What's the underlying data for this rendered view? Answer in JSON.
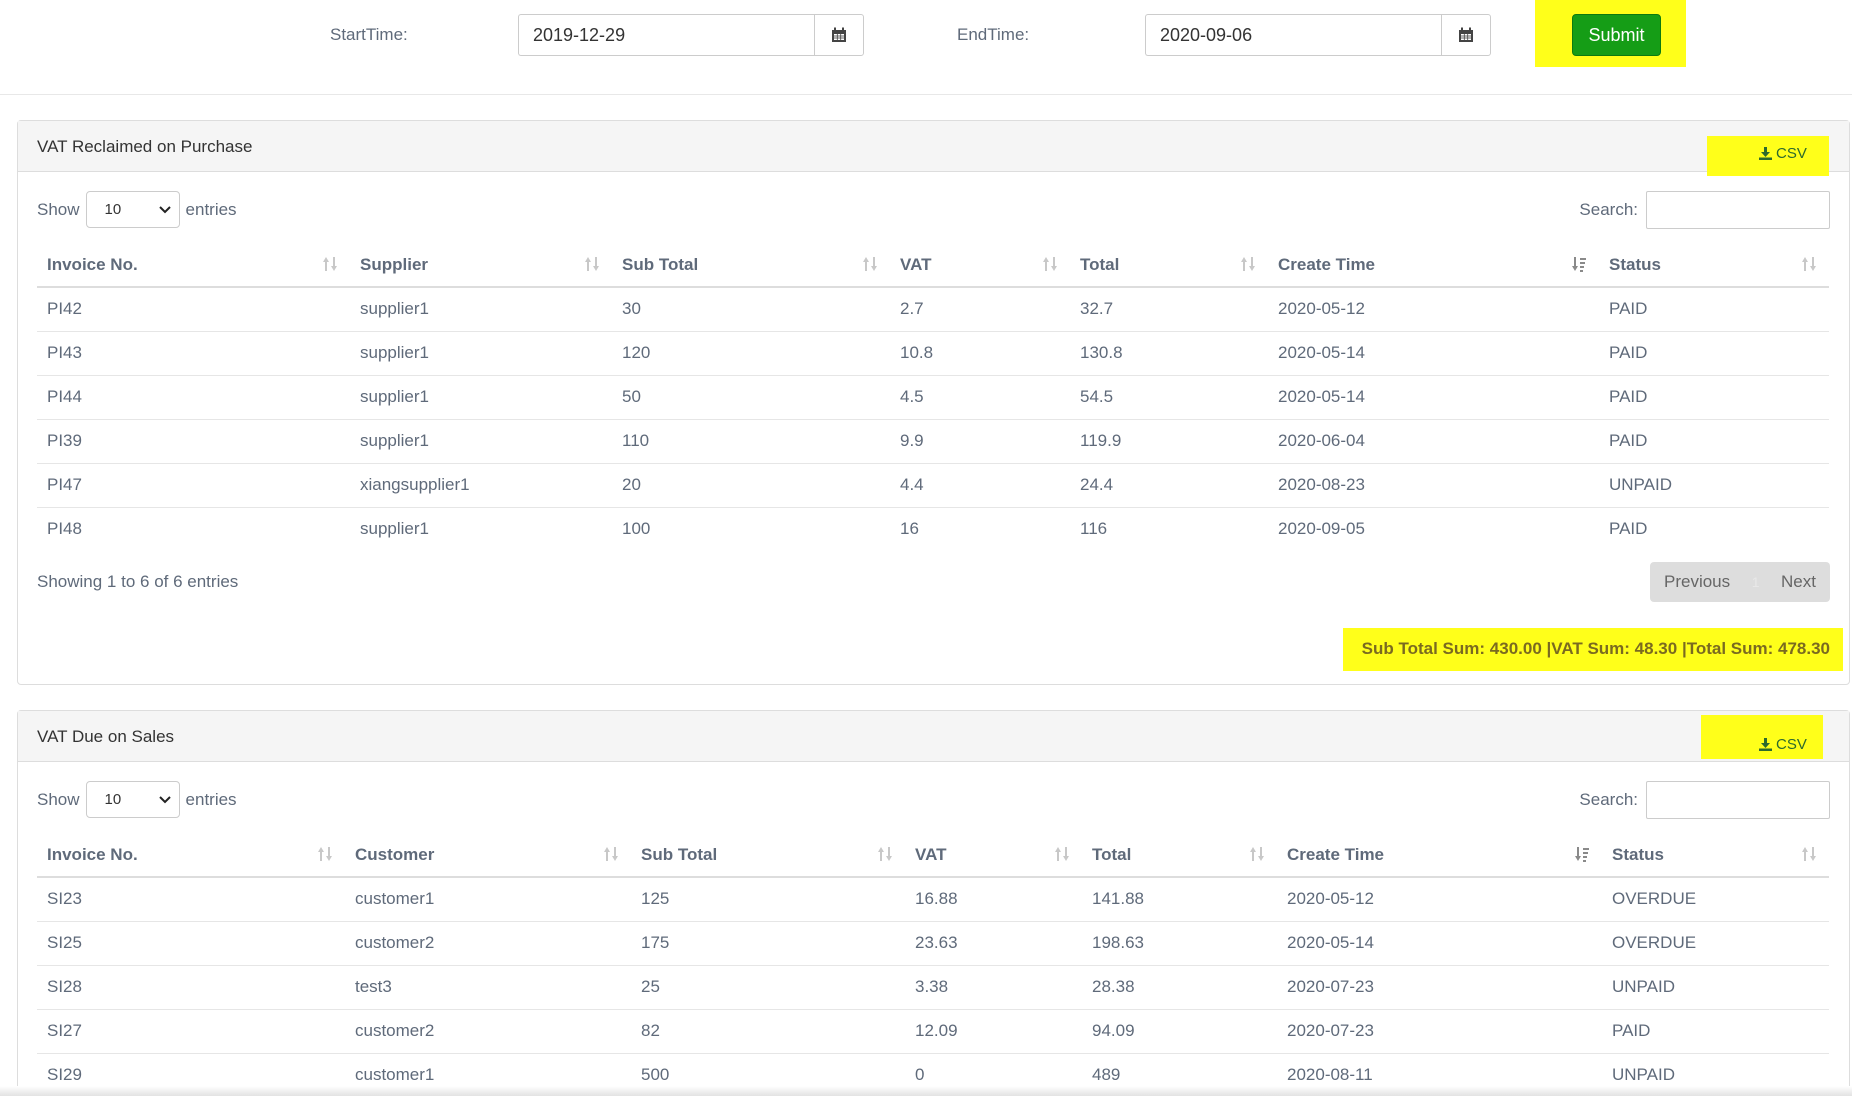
{
  "filters": {
    "start_label": "StartTime:",
    "start_value": "2019-12-29",
    "end_label": "EndTime:",
    "end_value": "2020-09-06",
    "submit_label": "Submit"
  },
  "purchase": {
    "title": "VAT Reclaimed on Purchase",
    "csv_label": "CSV",
    "show_label": "Show",
    "entries_label": "entries",
    "page_length": "10",
    "search_label": "Search:",
    "columns": [
      "Invoice No.",
      "Supplier",
      "Sub Total",
      "VAT",
      "Total",
      "Create Time",
      "Status"
    ],
    "rows": [
      [
        "PI42",
        "supplier1",
        "30",
        "2.7",
        "32.7",
        "2020-05-12",
        "PAID"
      ],
      [
        "PI43",
        "supplier1",
        "120",
        "10.8",
        "130.8",
        "2020-05-14",
        "PAID"
      ],
      [
        "PI44",
        "supplier1",
        "50",
        "4.5",
        "54.5",
        "2020-05-14",
        "PAID"
      ],
      [
        "PI39",
        "supplier1",
        "110",
        "9.9",
        "119.9",
        "2020-06-04",
        "PAID"
      ],
      [
        "PI47",
        "xiangsupplier1",
        "20",
        "4.4",
        "24.4",
        "2020-08-23",
        "UNPAID"
      ],
      [
        "PI48",
        "supplier1",
        "100",
        "16",
        "116",
        "2020-09-05",
        "PAID"
      ]
    ],
    "info": "Showing 1 to 6 of 6 entries",
    "previous_label": "Previous",
    "page_number": "1",
    "next_label": "Next",
    "sum_text": "Sub Total Sum: 430.00 |VAT Sum: 48.30 |Total Sum: 478.30"
  },
  "sales": {
    "title": "VAT Due on Sales",
    "csv_label": "CSV",
    "show_label": "Show",
    "entries_label": "entries",
    "page_length": "10",
    "search_label": "Search:",
    "columns": [
      "Invoice No.",
      "Customer",
      "Sub Total",
      "VAT",
      "Total",
      "Create Time",
      "Status"
    ],
    "rows": [
      [
        "SI23",
        "customer1",
        "125",
        "16.88",
        "141.88",
        "2020-05-12",
        "OVERDUE"
      ],
      [
        "SI25",
        "customer2",
        "175",
        "23.63",
        "198.63",
        "2020-05-14",
        "OVERDUE"
      ],
      [
        "SI28",
        "test3",
        "25",
        "3.38",
        "28.38",
        "2020-07-23",
        "UNPAID"
      ],
      [
        "SI27",
        "customer2",
        "82",
        "12.09",
        "94.09",
        "2020-07-23",
        "PAID"
      ],
      [
        "SI29",
        "customer1",
        "500",
        "0",
        "489",
        "2020-08-11",
        "UNPAID"
      ]
    ]
  },
  "colors": {
    "highlight": "#ffff1a",
    "submit_bg": "#159d16",
    "text": "#5f6a7a"
  },
  "icons": [
    "calendar-icon",
    "download-icon",
    "sort-icon",
    "sort-desc-icon",
    "chevron-down-icon"
  ]
}
